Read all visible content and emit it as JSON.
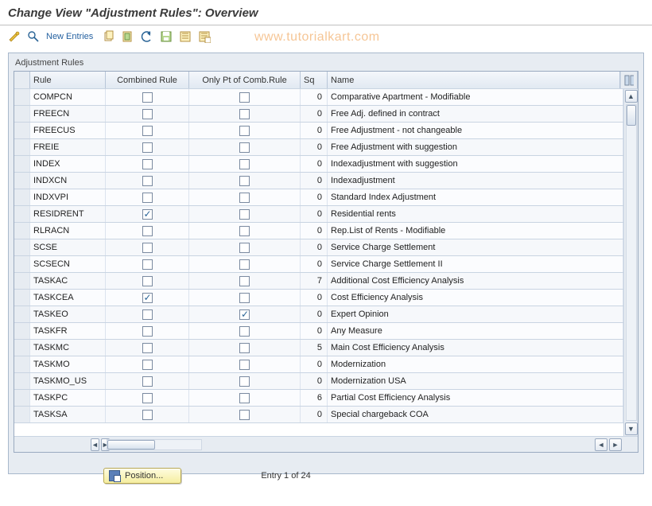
{
  "title": "Change View \"Adjustment Rules\": Overview",
  "toolbar": {
    "new_entries_label": "New Entries"
  },
  "watermark": "www.tutorialkart.com",
  "panel": {
    "label": "Adjustment Rules"
  },
  "columns": {
    "rule": "Rule",
    "combined": "Combined Rule",
    "only_pt": "Only Pt of Comb.Rule",
    "sq": "Sq",
    "name": "Name"
  },
  "rows": [
    {
      "rule": "COMPCN",
      "combined": false,
      "only_pt": false,
      "sq": 0,
      "name": "Comparative Apartment - Modifiable"
    },
    {
      "rule": "FREECN",
      "combined": false,
      "only_pt": false,
      "sq": 0,
      "name": "Free Adj. defined in contract"
    },
    {
      "rule": "FREECUS",
      "combined": false,
      "only_pt": false,
      "sq": 0,
      "name": "Free Adjustment - not changeable"
    },
    {
      "rule": "FREIE",
      "combined": false,
      "only_pt": false,
      "sq": 0,
      "name": "Free Adjustment with suggestion"
    },
    {
      "rule": "INDEX",
      "combined": false,
      "only_pt": false,
      "sq": 0,
      "name": "Indexadjustment with suggestion"
    },
    {
      "rule": "INDXCN",
      "combined": false,
      "only_pt": false,
      "sq": 0,
      "name": "Indexadjustment"
    },
    {
      "rule": "INDXVPI",
      "combined": false,
      "only_pt": false,
      "sq": 0,
      "name": "Standard Index Adjustment"
    },
    {
      "rule": "RESIDRENT",
      "combined": true,
      "only_pt": false,
      "sq": 0,
      "name": "Residential rents"
    },
    {
      "rule": "RLRACN",
      "combined": false,
      "only_pt": false,
      "sq": 0,
      "name": "Rep.List of Rents - Modifiable"
    },
    {
      "rule": "SCSE",
      "combined": false,
      "only_pt": false,
      "sq": 0,
      "name": "Service Charge Settlement"
    },
    {
      "rule": "SCSECN",
      "combined": false,
      "only_pt": false,
      "sq": 0,
      "name": "Service Charge Settlement II"
    },
    {
      "rule": "TASKAC",
      "combined": false,
      "only_pt": false,
      "sq": 7,
      "name": "Additional Cost Efficiency Analysis"
    },
    {
      "rule": "TASKCEA",
      "combined": true,
      "only_pt": false,
      "sq": 0,
      "name": "Cost Efficiency Analysis"
    },
    {
      "rule": "TASKEO",
      "combined": false,
      "only_pt": true,
      "sq": 0,
      "name": "Expert Opinion"
    },
    {
      "rule": "TASKFR",
      "combined": false,
      "only_pt": false,
      "sq": 0,
      "name": "Any Measure"
    },
    {
      "rule": "TASKMC",
      "combined": false,
      "only_pt": false,
      "sq": 5,
      "name": "Main Cost Efficiency Analysis"
    },
    {
      "rule": "TASKMO",
      "combined": false,
      "only_pt": false,
      "sq": 0,
      "name": "Modernization"
    },
    {
      "rule": "TASKMO_US",
      "combined": false,
      "only_pt": false,
      "sq": 0,
      "name": "Modernization USA"
    },
    {
      "rule": "TASKPC",
      "combined": false,
      "only_pt": false,
      "sq": 6,
      "name": "Partial Cost Efficiency Analysis"
    },
    {
      "rule": "TASKSA",
      "combined": false,
      "only_pt": false,
      "sq": 0,
      "name": "Special chargeback COA"
    }
  ],
  "footer": {
    "position_label": "Position...",
    "entry_label": "Entry 1 of 24"
  }
}
